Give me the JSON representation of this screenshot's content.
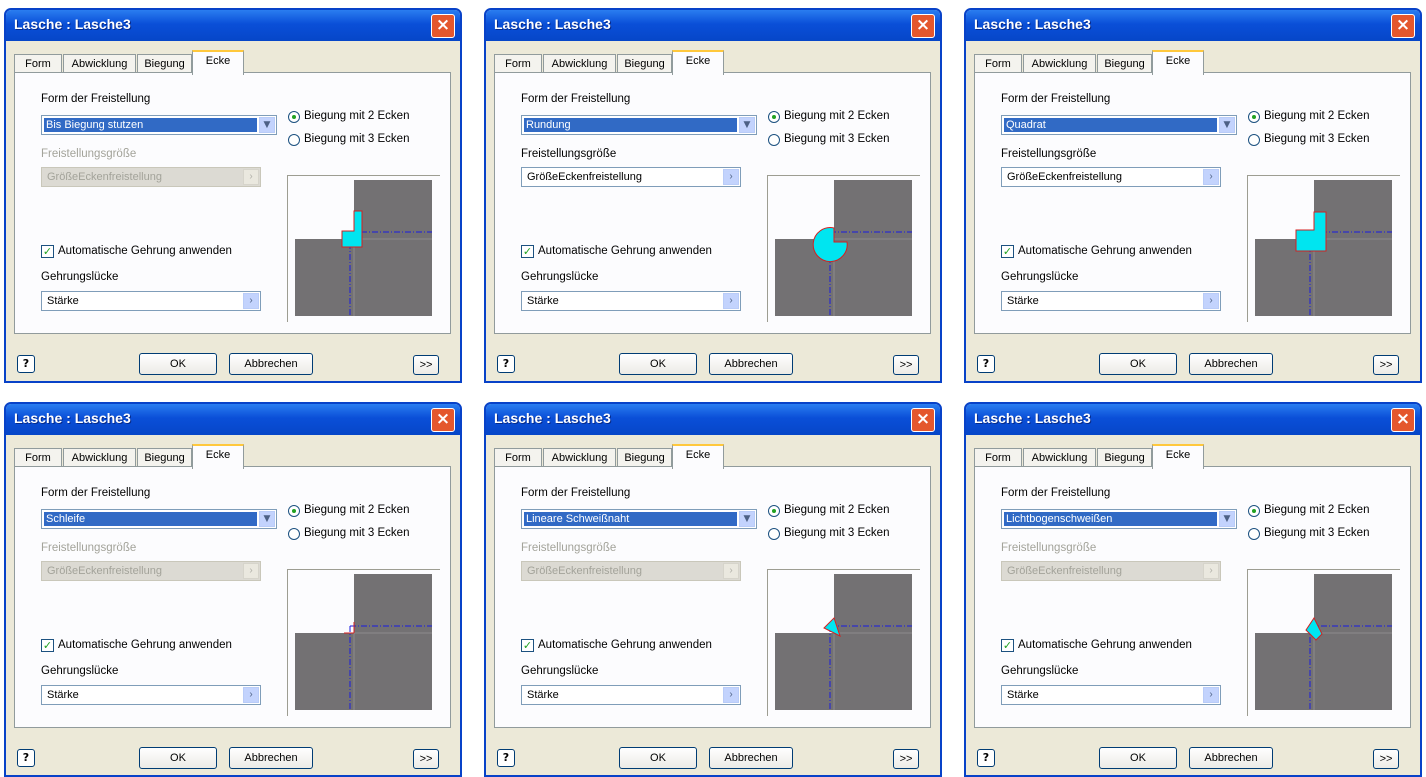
{
  "dialogs": [
    {
      "title": "Lasche : Lasche3",
      "form_value": "Bis Biegung stutzen",
      "size_enabled": false,
      "shape": "stutzen"
    },
    {
      "title": "Lasche : Lasche3",
      "form_value": "Rundung",
      "size_enabled": true,
      "shape": "rund"
    },
    {
      "title": "Lasche : Lasche3",
      "form_value": "Quadrat",
      "size_enabled": true,
      "shape": "quadrat"
    },
    {
      "title": "Lasche : Lasche3",
      "form_value": "Schleife",
      "size_enabled": false,
      "shape": "schleife"
    },
    {
      "title": "Lasche : Lasche3",
      "form_value": "Lineare Schweißnaht",
      "size_enabled": false,
      "shape": "linear"
    },
    {
      "title": "Lasche : Lasche3",
      "form_value": "Lichtbogenschweißen",
      "size_enabled": false,
      "shape": "bogen"
    }
  ],
  "tabs": [
    "Form",
    "Abwicklung",
    "Biegung",
    "Ecke"
  ],
  "active_tab": "Ecke",
  "labels": {
    "form": "Form der Freistellung",
    "radio_2": "Biegung mit 2 Ecken",
    "radio_3": "Biegung mit 3 Ecken",
    "size": "Freistellungsgröße",
    "size_value": "GrößeEckenfreistellung",
    "auto_miter": "Automatische Gehrung anwenden",
    "gap": "Gehrungslücke",
    "gap_value": "Stärke"
  },
  "buttons": {
    "ok": "OK",
    "cancel": "Abbrechen",
    "more": ">>",
    "help": "?",
    "close": "×"
  },
  "colors": {
    "titlebar": "#0a4fd8",
    "face": "#ece9d8",
    "selection": "#316ac5",
    "relief": "#00e5f0",
    "sheet": "#737173"
  }
}
